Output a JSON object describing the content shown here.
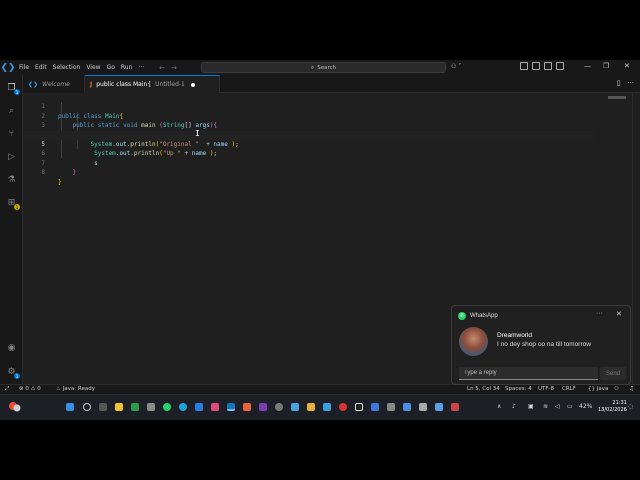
{
  "menu": [
    "File",
    "Edit",
    "Selection",
    "View",
    "Go",
    "Run",
    "···"
  ],
  "search": {
    "label": "Search"
  },
  "activity_badges": {
    "explorer": "1",
    "extensions": "1",
    "settings": "1"
  },
  "tabs": [
    {
      "icon": "vscode-icon",
      "label": "Welcome",
      "active": false
    },
    {
      "icon": "J",
      "label": "public class Main{",
      "sublabel": "Untitled-1",
      "modified": true,
      "active": true
    }
  ],
  "editor": {
    "line_numbers": [
      "1",
      "2",
      "3",
      "4",
      "5",
      "6",
      "7",
      "8"
    ],
    "current_line": 5
  },
  "notification": {
    "app": "WhatsApp",
    "sender": "Dreamworld",
    "message": "I no dey shop oo na till tomorrow",
    "reply_placeholder": "Type a reply",
    "send_label": "Send"
  },
  "statusbar": {
    "errors": "0",
    "warnings": "0",
    "java_status": "Java: Ready",
    "position": "Ln 5, Col 34",
    "spaces": "Spaces: 4",
    "encoding": "UTF-8",
    "eol": "CRLF",
    "language": "{} Java"
  },
  "taskbar": {
    "battery": "42%",
    "time": "21:31",
    "date": "13/02/2026"
  }
}
